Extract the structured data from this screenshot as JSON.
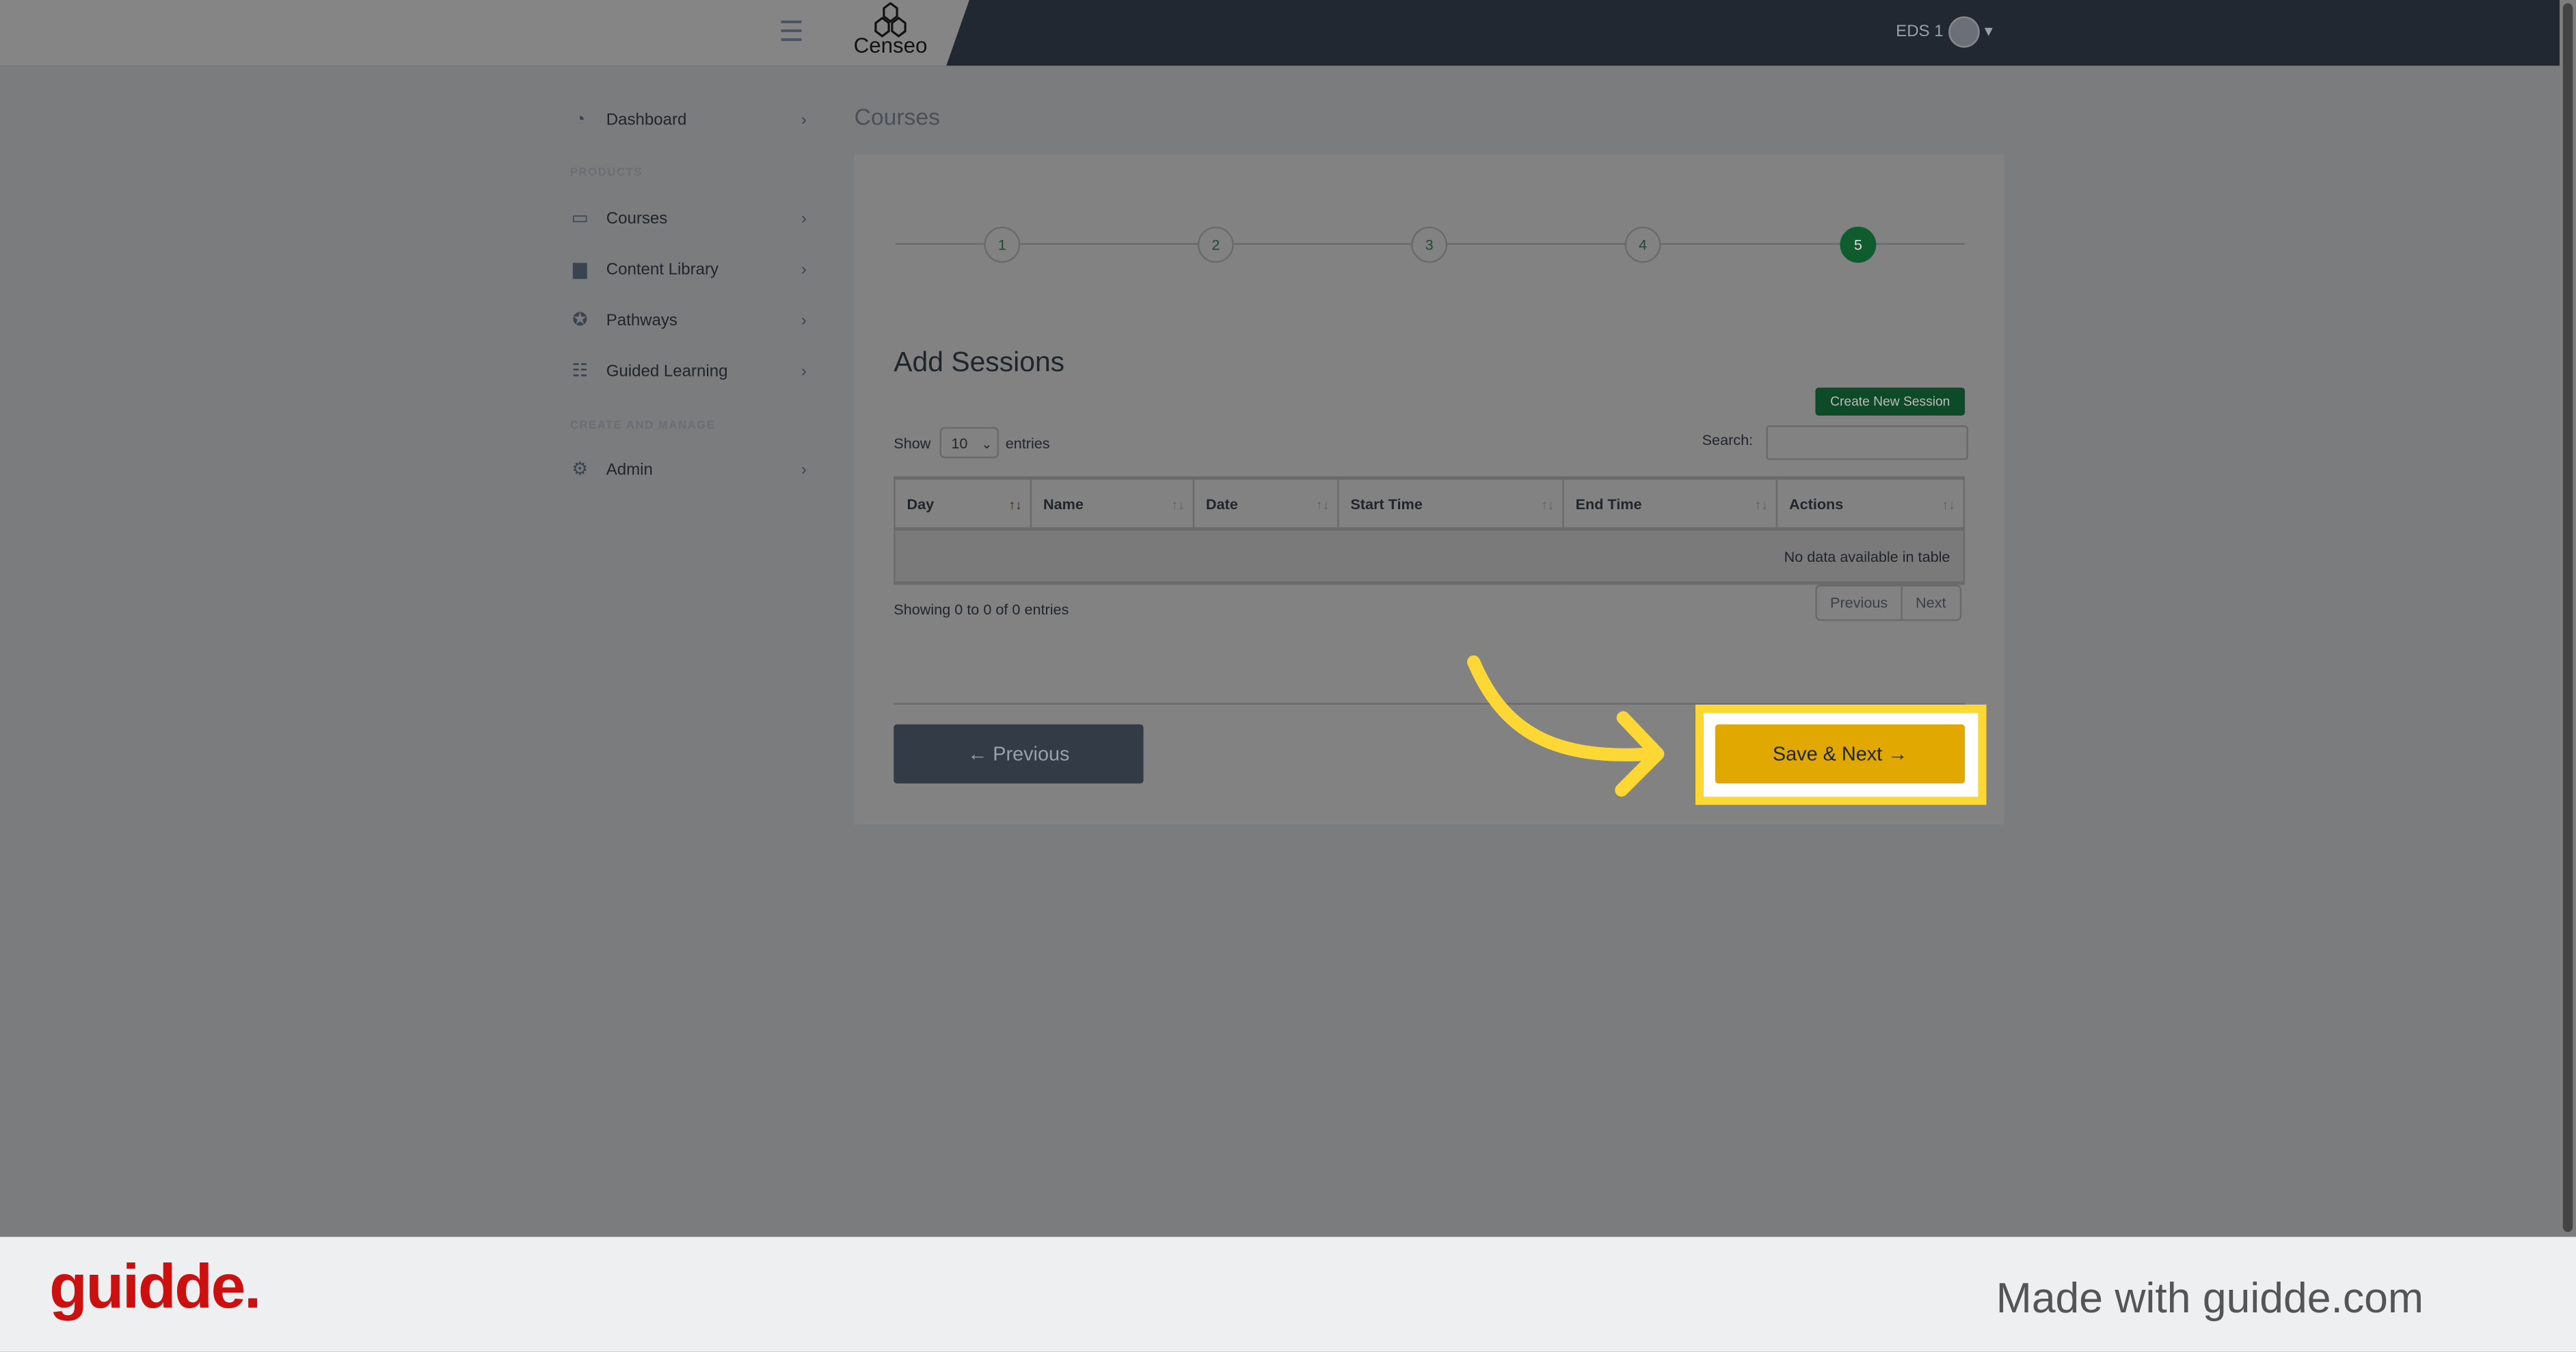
{
  "header": {
    "menu_icon": "hamburger-icon",
    "logo_text": "Censeo",
    "user": "EDS 1"
  },
  "sidebar": {
    "items": [
      {
        "label": "Dashboard",
        "icon": "dashboard-gauge-icon"
      },
      {
        "label": "Courses",
        "icon": "teacher-board-icon"
      },
      {
        "label": "Content Library",
        "icon": "book-icon"
      },
      {
        "label": "Pathways",
        "icon": "award-ribbon-icon"
      },
      {
        "label": "Guided Learning",
        "icon": "clipboard-list-icon"
      },
      {
        "label": "Admin",
        "icon": "gear-icon"
      }
    ],
    "sections": [
      "PRODUCTS",
      "CREATE AND MANAGE"
    ]
  },
  "page": {
    "title": "Courses"
  },
  "wizard": {
    "steps": [
      "1",
      "2",
      "3",
      "4",
      "5"
    ],
    "active_step": 5,
    "active_color": "#0f5c2e"
  },
  "sessions": {
    "heading": "Add Sessions",
    "create_label": "Create New Session",
    "show_label": "Show",
    "entries_value": "10",
    "entries_label": "entries",
    "search_label": "Search:",
    "search_value": "",
    "columns": [
      "Day",
      "Name",
      "Date",
      "Start Time",
      "End Time",
      "Actions"
    ],
    "empty_text": "No data available in table",
    "info": "Showing 0 to 0 of 0 entries",
    "pager_prev": "Previous",
    "pager_next": "Next"
  },
  "footer_buttons": {
    "previous": "← Previous",
    "save_next": "Save & Next →",
    "save_color": "#e0a800",
    "highlight_color": "#fdd835"
  },
  "watermark": {
    "brand": "guidde.",
    "tagline": "Made with guidde.com",
    "brand_color": "#cc1010"
  }
}
